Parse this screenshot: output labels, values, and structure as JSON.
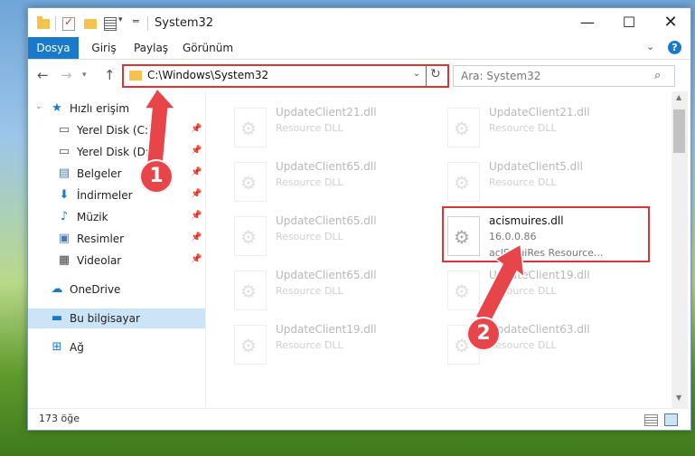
{
  "window": {
    "title": "System32",
    "controls": {
      "minimize": "—",
      "maximize": "☐",
      "close": "✕"
    }
  },
  "ribbon": {
    "tabs": [
      "Dosya",
      "Giriş",
      "Paylaş",
      "Görünüm"
    ],
    "help": "?"
  },
  "nav": {
    "address": "C:\\Windows\\System32",
    "search_placeholder": "Ara: System32"
  },
  "sidebar": {
    "items": [
      {
        "label": "Hızlı erişim",
        "icon": "star-icon"
      },
      {
        "label": "Yerel Disk (C:)",
        "icon": "drive-icon"
      },
      {
        "label": "Yerel Disk (D:)",
        "icon": "drive-icon"
      },
      {
        "label": "Belgeler",
        "icon": "documents-icon"
      },
      {
        "label": "İndirmeler",
        "icon": "download-icon"
      },
      {
        "label": "Müzik",
        "icon": "music-icon"
      },
      {
        "label": "Resimler",
        "icon": "pictures-icon"
      },
      {
        "label": "Videolar",
        "icon": "videos-icon"
      },
      {
        "label": "OneDrive",
        "icon": "cloud-icon"
      },
      {
        "label": "Bu bilgisayar",
        "icon": "computer-icon"
      },
      {
        "label": "Ağ",
        "icon": "network-icon"
      }
    ]
  },
  "files": [
    {
      "name": "UpdateClient21.dll",
      "desc": "Resource DLL"
    },
    {
      "name": "UpdateClient21.dll",
      "desc": "Resource DLL"
    },
    {
      "name": "UpdateClient65.dll",
      "desc": "Resource DLL"
    },
    {
      "name": "UpdateClient5.dll",
      "desc": "Resource DLL"
    },
    {
      "name": "UpdateClient65.dll",
      "desc": "Resource DLL"
    },
    {
      "name": "acismuires.dll",
      "version": "16.0.0.86",
      "desc": "aclSMuiRes Resource..."
    },
    {
      "name": "UpdateClient65.dll",
      "desc": "Resource DLL"
    },
    {
      "name": "UpdateClient19.dll",
      "desc": "Resource DLL"
    },
    {
      "name": "UpdateClient19.dll",
      "desc": "Resource DLL"
    },
    {
      "name": "UpdateClient63.dll",
      "desc": "Resource DLL"
    }
  ],
  "status": {
    "count": "173 öğe"
  },
  "annotations": {
    "step1": "1",
    "step2": "2",
    "color": "#e8454b"
  }
}
